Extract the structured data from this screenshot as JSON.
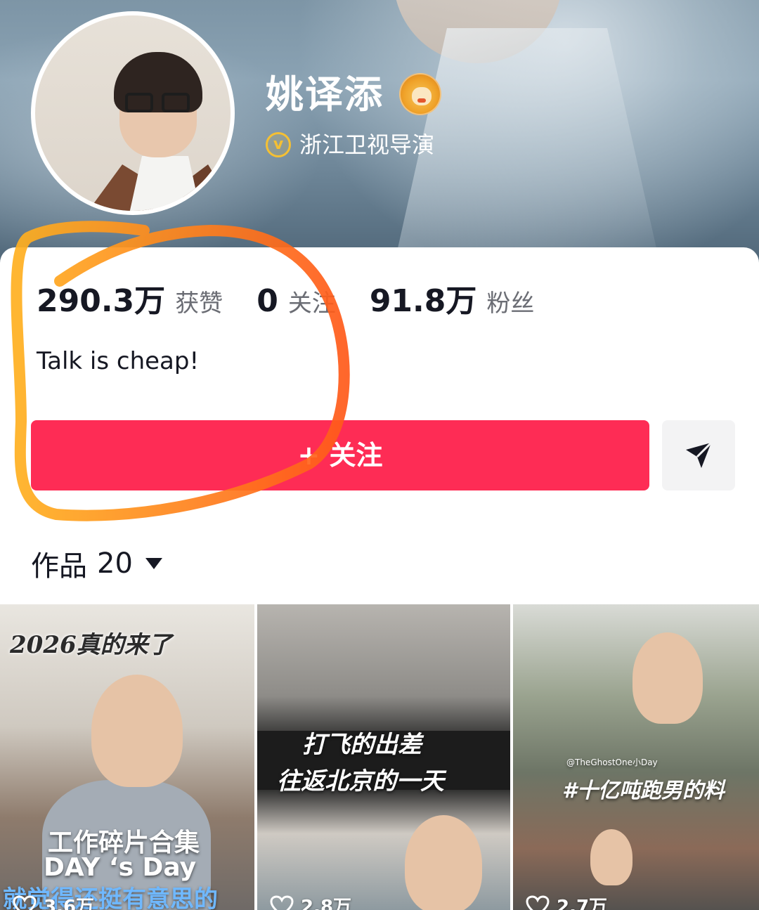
{
  "profile": {
    "name": "姚译添",
    "badge_icon": "lion-emoji-icon",
    "verification_icon": "verified-v-icon",
    "verification": "浙江卫视导演",
    "bio": "Talk is cheap!"
  },
  "stats": [
    {
      "value": "290.3万",
      "label": "获赞"
    },
    {
      "value": "0",
      "label": "关注"
    },
    {
      "value": "91.8万",
      "label": "粉丝"
    }
  ],
  "actions": {
    "follow_label": "+ 关注",
    "share_icon": "send-icon"
  },
  "works": {
    "label": "作品",
    "count": "20"
  },
  "videos": [
    {
      "top_caption": "2026真的来了",
      "caption_lines": [
        "工作碎片合集",
        "DAY ‘s Day",
        "就觉得还挺有意思的"
      ],
      "likes": "3.6万"
    },
    {
      "caption_lines": [
        "打飞的出差",
        "往返北京的一天"
      ],
      "likes": "2.8万"
    },
    {
      "handle": "@TheGhostOne小Day",
      "caption_lines": [
        "#十亿吨跑男的料"
      ],
      "likes": "2.7万"
    }
  ],
  "colors": {
    "follow_button": "#fe2c55",
    "annotation_stroke": "#ff7a18",
    "verification_badge": "#f5c033"
  }
}
